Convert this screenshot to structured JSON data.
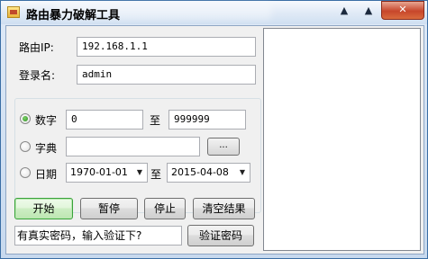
{
  "window": {
    "title": "路由暴力破解工具"
  },
  "controls": {
    "minimize": "▲",
    "maximize": "▲",
    "close": "✕"
  },
  "form": {
    "router_ip_label": "路由IP:",
    "router_ip_value": "192.168.1.1",
    "login_name_label": "登录名:",
    "login_name_value": "admin"
  },
  "mode": {
    "selected": "数字",
    "number": {
      "label": "数字",
      "from": "0",
      "to_label": "至",
      "to": "999999"
    },
    "dictionary": {
      "label": "字典",
      "path": "",
      "browse_label": "..."
    },
    "date": {
      "label": "日期",
      "from": "1970-01-01",
      "to_label": "至",
      "to": "2015-04-08"
    }
  },
  "buttons": {
    "start": "开始",
    "pause": "暂停",
    "stop": "停止",
    "clear": "清空结果",
    "verify": "验证密码"
  },
  "verify": {
    "hint_value": "有真实密码，输入验证下?"
  },
  "results": {
    "lines": []
  }
}
